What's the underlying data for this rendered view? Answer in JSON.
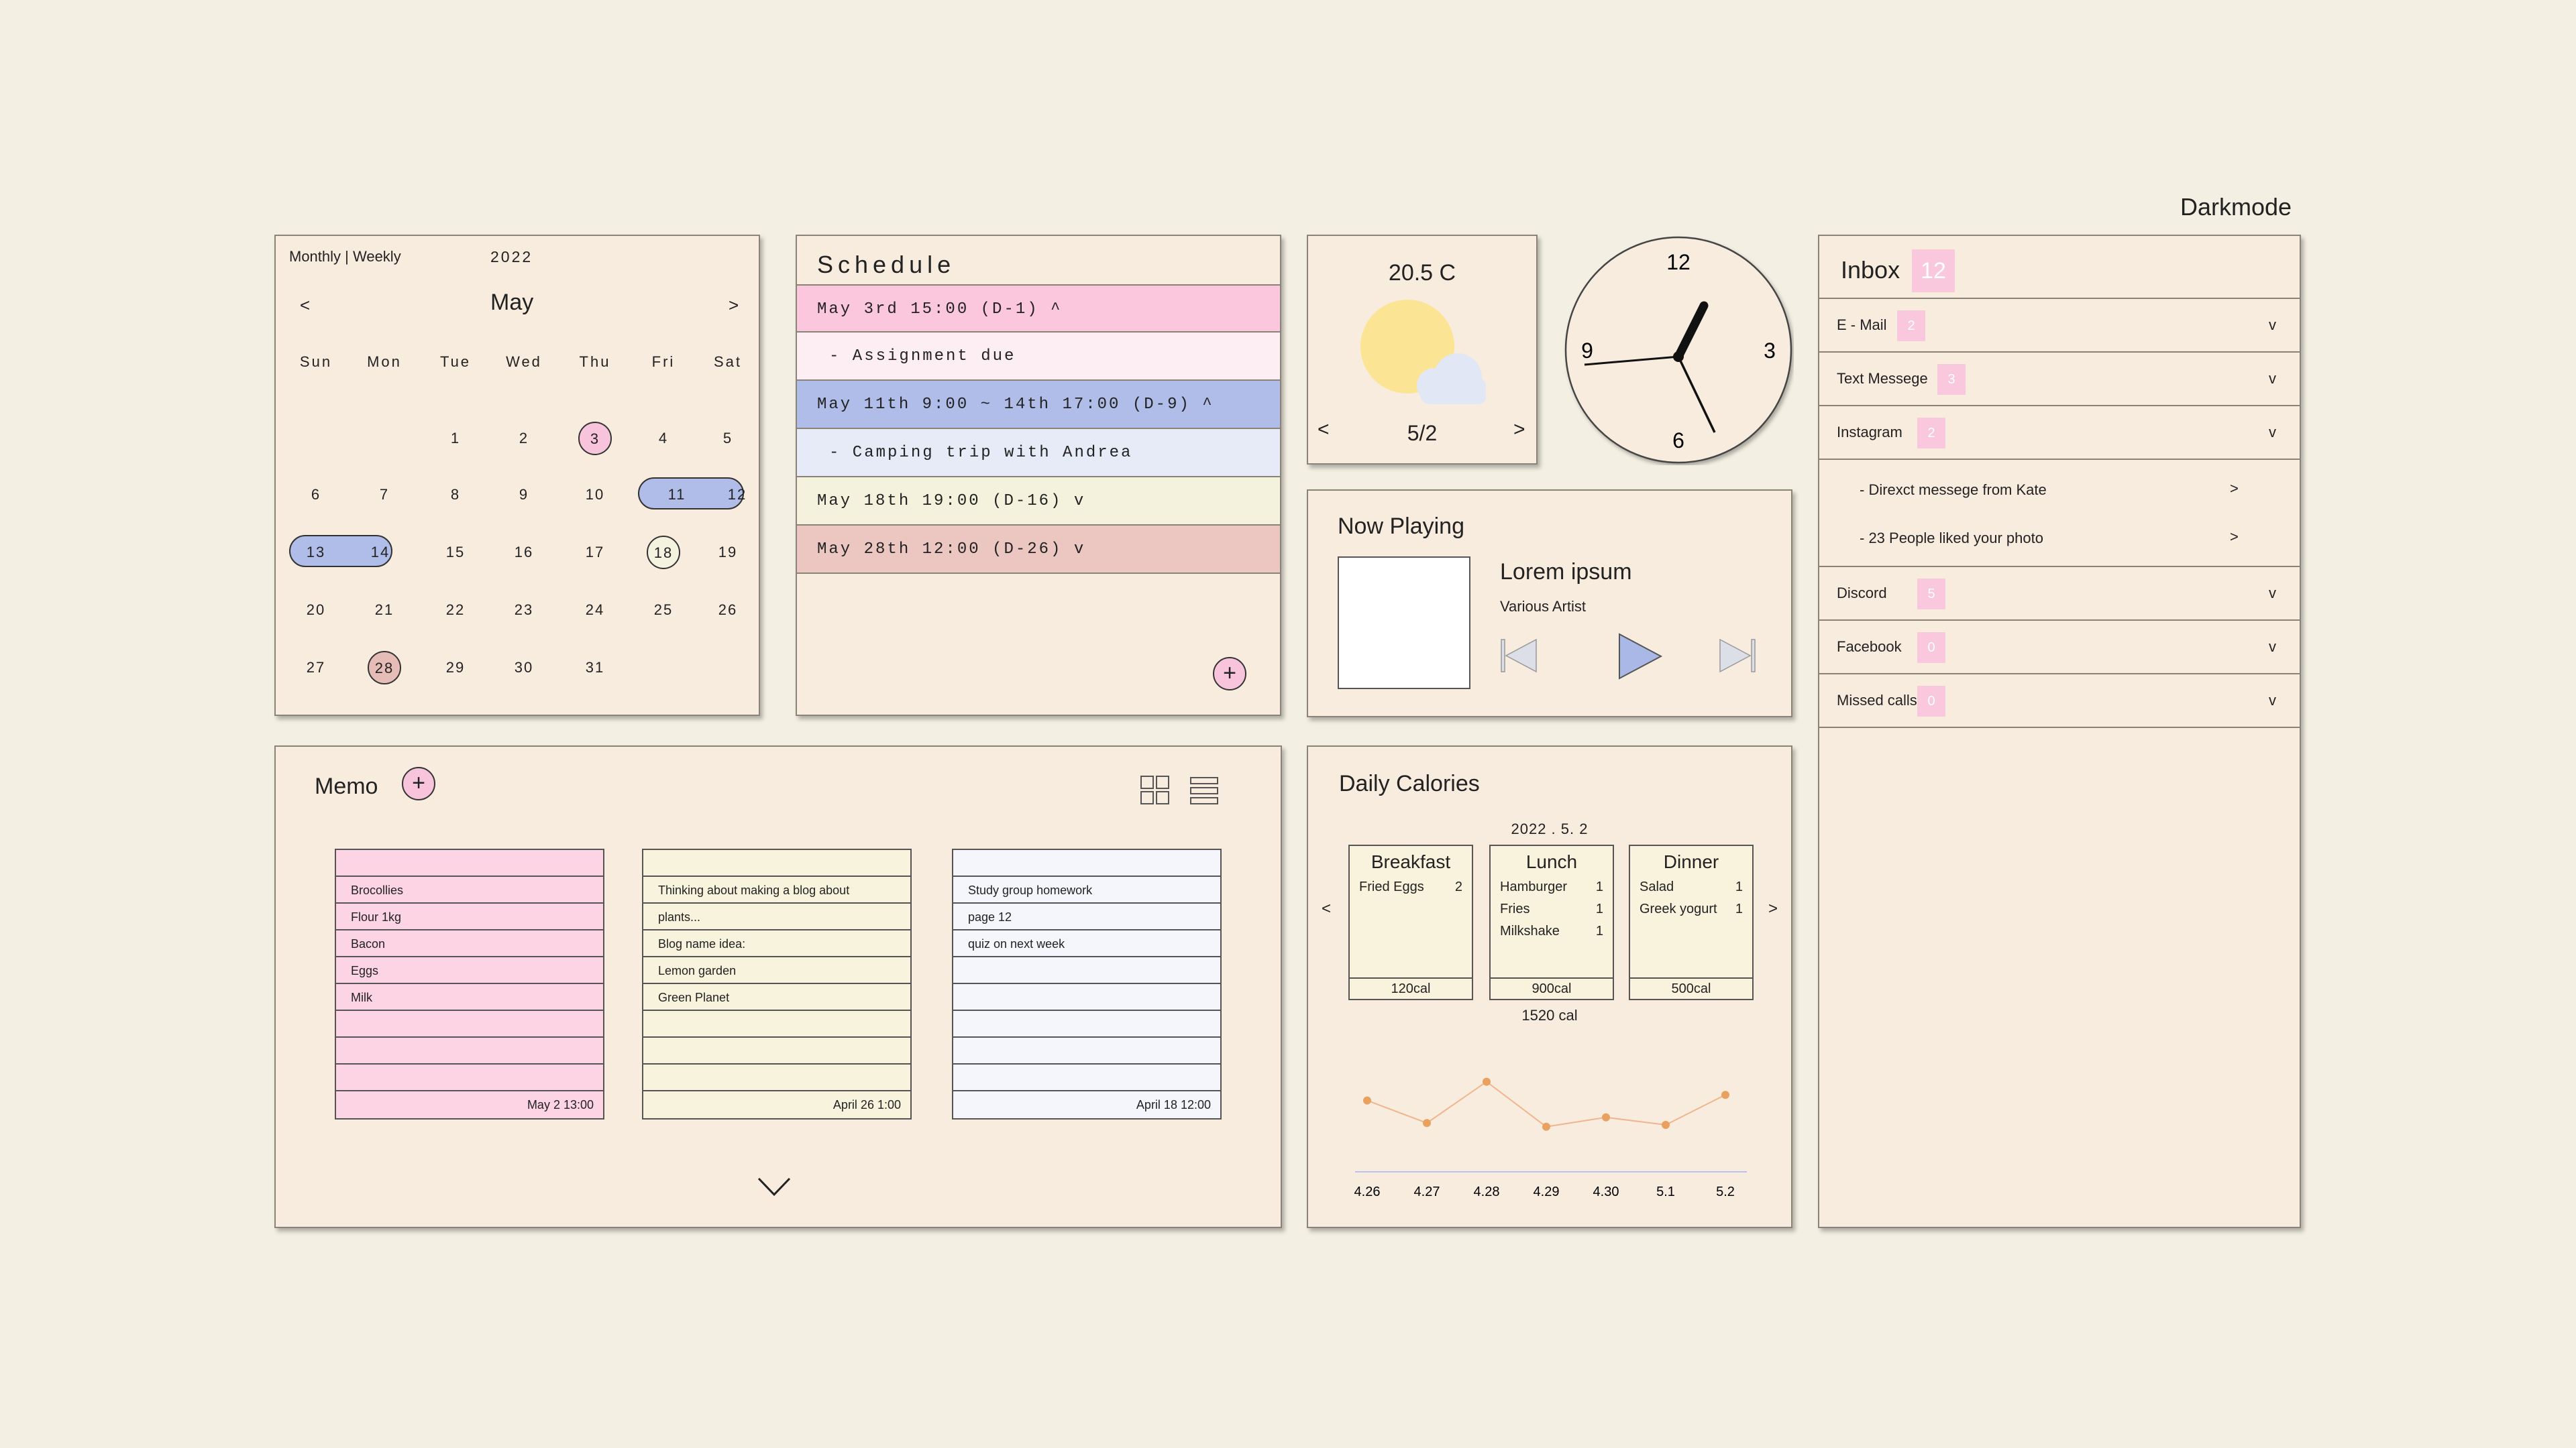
{
  "darkmode_label": "Darkmode",
  "calendar": {
    "mode": "Monthly | Weekly",
    "year": "2022",
    "prev": "<",
    "next": ">",
    "month": "May",
    "weekdays": [
      "Sun",
      "Mon",
      "Tue",
      "Wed",
      "Thu",
      "Fri",
      "Sat"
    ],
    "days": [
      "1",
      "2",
      "3",
      "4",
      "5",
      "6",
      "7",
      "8",
      "9",
      "10",
      "11",
      "12",
      "13",
      "14",
      "15",
      "16",
      "17",
      "18",
      "19",
      "20",
      "21",
      "22",
      "23",
      "24",
      "25",
      "26",
      "27",
      "28",
      "29",
      "30",
      "31"
    ]
  },
  "schedule": {
    "title": "Schedule",
    "items": [
      "May 3rd 15:00 (D-1) ^",
      "- Assignment due",
      "May 11th 9:00 ~ 14th 17:00 (D-9) ^",
      "- Camping trip with Andrea",
      "May 18th 19:00 (D-16) v",
      "May 28th 12:00 (D-26) v"
    ],
    "colors": [
      "#fbc7dc",
      "#fdeef4",
      "#afbde8",
      "#e6ebf7",
      "#f4f2dd",
      "#ecc7c2"
    ],
    "add_label": "+"
  },
  "weather": {
    "temp": "20.5 C",
    "date": "5/2",
    "prev": "<",
    "next": ">"
  },
  "clock": {
    "labels": [
      "12",
      "3",
      "6",
      "9"
    ]
  },
  "now_playing": {
    "title": "Now Playing",
    "song": "Lorem ipsum",
    "artist": "Various Artist"
  },
  "memo": {
    "title": "Memo",
    "add_label": "+",
    "notes": [
      {
        "color": "#fdd4e3",
        "lines": [
          "",
          "Brocollies",
          "Flour 1kg",
          "Bacon",
          "Eggs",
          "Milk",
          "",
          "",
          "",
          "May 2 13:00"
        ]
      },
      {
        "color": "#f8f3dc",
        "lines": [
          "",
          "Thinking about making a blog about",
          "plants...",
          "Blog name idea:",
          "Lemon garden",
          "Green Planet",
          "",
          "",
          "",
          "April 26 1:00"
        ]
      },
      {
        "color": "#f4f6fb",
        "lines": [
          "",
          "Study group homework",
          "page 12",
          "quiz on next week",
          "",
          "",
          "",
          "",
          "",
          "April 18 12:00"
        ]
      }
    ]
  },
  "calories": {
    "title": "Daily Calories",
    "date": "2022 . 5. 2",
    "prev": "<",
    "next": ">",
    "meals": [
      {
        "name": "Breakfast",
        "items": [
          {
            "food": "Fried Eggs",
            "qty": "2"
          }
        ],
        "total": "120cal"
      },
      {
        "name": "Lunch",
        "items": [
          {
            "food": "Hamburger",
            "qty": "1"
          },
          {
            "food": "Fries",
            "qty": "1"
          },
          {
            "food": "Milkshake",
            "qty": "1"
          }
        ],
        "total": "900cal"
      },
      {
        "name": "Dinner",
        "items": [
          {
            "food": "Salad",
            "qty": "1"
          },
          {
            "food": "Greek yogurt",
            "qty": "1"
          }
        ],
        "total": "500cal"
      }
    ],
    "sum": "1520 cal",
    "chart_data": {
      "type": "line",
      "categories": [
        "4.26",
        "4.27",
        "4.28",
        "4.29",
        "4.30",
        "5.1",
        "5.2"
      ],
      "values": [
        0.66,
        0.42,
        0.86,
        0.38,
        0.48,
        0.4,
        0.72
      ],
      "line_color": "#f0b58c",
      "point_color": "#e9a15f"
    }
  },
  "inbox": {
    "title": "Inbox",
    "count": "12",
    "rows": [
      {
        "label": "E - Mail",
        "count": "2",
        "chev": "v"
      },
      {
        "label": "Text Messege",
        "count": "3",
        "chev": "v"
      },
      {
        "label": "Instagram",
        "count": "2",
        "chev": "v"
      }
    ],
    "instagram_sub": [
      {
        "label": "-  Direxct messege from Kate",
        "arrow": ">"
      },
      {
        "label": "-  23 People liked your photo",
        "arrow": ">"
      }
    ],
    "rows2": [
      {
        "label": "Discord",
        "count": "5",
        "chev": "v"
      },
      {
        "label": "Facebook",
        "count": "0",
        "chev": "v"
      },
      {
        "label": "Missed calls",
        "count": "0",
        "chev": "v"
      }
    ]
  }
}
